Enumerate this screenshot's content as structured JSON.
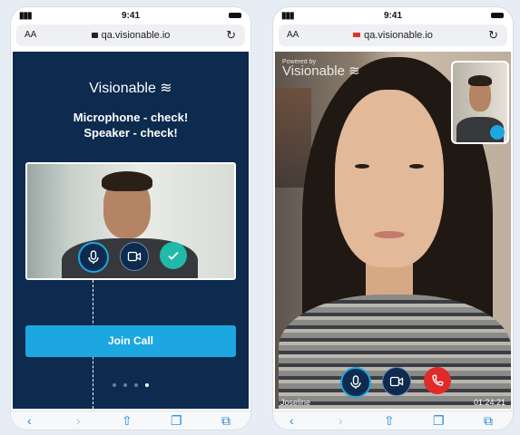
{
  "left_phone": {
    "status": {
      "time": "9:41"
    },
    "browser": {
      "text_size": "AA",
      "url": "qa.visionable.io"
    },
    "brand": "Visionable",
    "headline_line1": "Microphone - check!",
    "headline_line2": "Speaker - check!",
    "join_button": "Join Call",
    "pagination": {
      "total": 4,
      "active": 4
    }
  },
  "right_phone": {
    "status": {
      "time": "9:41"
    },
    "browser": {
      "text_size": "AA",
      "url": "qa.visionable.io"
    },
    "powered_by": "Powered by",
    "brand": "Visionable",
    "participant_name": "Joseline",
    "call_timer": "01:24:21"
  },
  "icons": {
    "mic": "mic-icon",
    "camera": "video-camera-icon",
    "check": "check-icon",
    "hangup": "phone-hangup-icon",
    "switch_camera": "switch-camera-icon",
    "back": "back-icon",
    "forward": "forward-icon",
    "share": "share-icon",
    "bookmarks": "bookmarks-icon",
    "tabs": "tabs-icon"
  },
  "colors": {
    "navy": "#0d2a4f",
    "accent": "#1ca7e0",
    "success": "#21b9a8",
    "danger": "#e02b2b"
  }
}
